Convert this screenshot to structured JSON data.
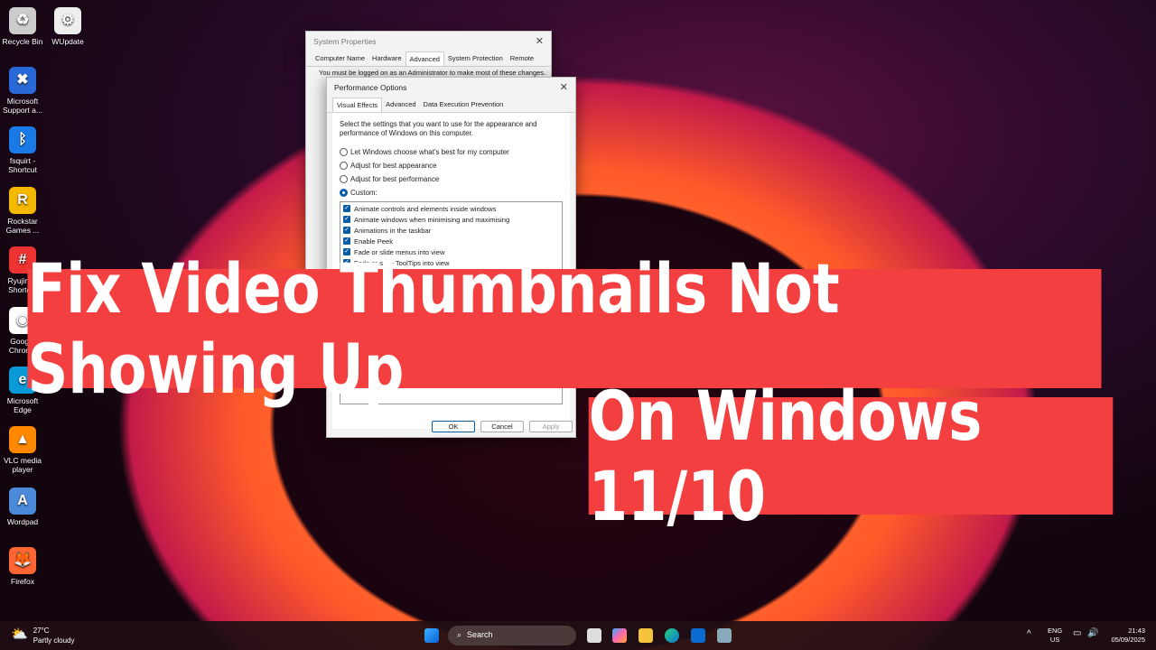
{
  "desktop_icons": [
    {
      "label": "Recycle Bin",
      "icon": "recycle-bin-icon"
    },
    {
      "label": "WUpdate",
      "icon": "settings-icon"
    },
    {
      "label": "Microsoft Support a...",
      "icon": "tools-icon"
    },
    {
      "label": "fsquirt - Shortcut",
      "icon": "bluetooth-icon"
    },
    {
      "label": "Rockstar Games ...",
      "icon": "rockstar-icon"
    },
    {
      "label": "Ryujinx - Shortcut",
      "icon": "ryujinx-icon"
    },
    {
      "label": "Google Chrome",
      "icon": "chrome-icon"
    },
    {
      "label": "Microsoft Edge",
      "icon": "edge-icon"
    },
    {
      "label": "VLC media player",
      "icon": "vlc-icon"
    },
    {
      "label": "Wordpad",
      "icon": "wordpad-icon"
    },
    {
      "label": "Firefox",
      "icon": "firefox-icon"
    }
  ],
  "system_properties": {
    "title": "System Properties",
    "tabs": [
      "Computer Name",
      "Hardware",
      "Advanced",
      "System Protection",
      "Remote"
    ],
    "active_tab": "Advanced",
    "notice": "You must be logged on as an Administrator to make most of these changes."
  },
  "performance_options": {
    "title": "Performance Options",
    "tabs": [
      "Visual Effects",
      "Advanced",
      "Data Execution Prevention"
    ],
    "active_tab": "Visual Effects",
    "description": "Select the settings that you want to use for the appearance and performance of Windows on this computer.",
    "radios": [
      "Let Windows choose what's best for my computer",
      "Adjust for best appearance",
      "Adjust for best performance",
      "Custom:"
    ],
    "selected": "Custom:",
    "checkboxes": [
      "Animate controls and elements inside windows",
      "Animate windows when minimising and maximising",
      "Animations in the taskbar",
      "Enable Peek",
      "Fade or slide menus into view",
      "Fade or slide ToolTips into view"
    ],
    "ok": "OK",
    "cancel": "Cancel",
    "apply": "Apply"
  },
  "banner": {
    "line1": "Fix Video Thumbnails Not Showing Up",
    "line2": "On Windows 11/10",
    "color": "#f33f3f"
  },
  "taskbar": {
    "weather_temp": "27°C",
    "weather_desc": "Partly cloudy",
    "search": "Search",
    "lang": "ENG",
    "region": "US",
    "time": "21:43",
    "date": "05/09/2025"
  }
}
